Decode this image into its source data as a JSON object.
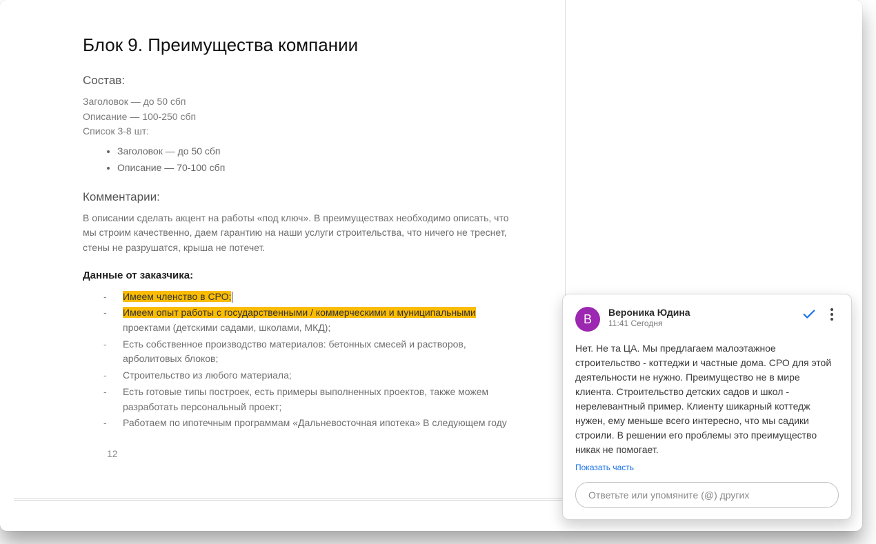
{
  "doc": {
    "title": "Блок 9. Преимущества компании",
    "sostav_heading": "Состав:",
    "sostav_lines": {
      "l1": "Заголовок — до 50 сбп",
      "l2": "Описание — 100-250 сбп",
      "l3": "Список 3-8 шт:"
    },
    "sostav_bullets": {
      "b1": "Заголовок — до 50 сбп",
      "b2": "Описание  — 70-100 сбп"
    },
    "comments_heading": "Комментарии:",
    "comments_para": "В описании сделать акцент на работы «под ключ».  В преимуществах необходимо описать, что мы строим качественно, даем гарантию на наши услуги строительства, что ничего не треснет, стены не разрушатся, крыша не потечет.",
    "client_data_heading": "Данные от заказчика:",
    "client_items": {
      "i1_hl": "Имеем членство в СРО;",
      "i2_hl": "Имеем опыт работы с государственными / коммерческими и муниципальными",
      "i2_rest": " проектами (детскими садами, школами, МКД);",
      "i3": "Есть собственное производство материалов: бетонных смесей и растворов, арболитовых блоков;",
      "i4": "Строительство из любого материала;",
      "i5": "Есть готовые типы построек, есть примеры выполненных проектов, также можем разработать персональный проект;",
      "i6": "Работаем по ипотечным программам «Дальневосточная ипотека» В следующем году"
    },
    "page_number": "12"
  },
  "comment": {
    "avatar_initial": "В",
    "author": "Вероника Юдина",
    "time": "11:41 Сегодня",
    "body": "Нет. Не та ЦА. Мы предлагаем малоэтажное строительство - коттеджи и частные дома. СРО для этой деятельности не нужно. Преимущество не в мире клиента. Строительство детских садов и школ - нерелевантный пример. Клиенту шикарный коттедж нужен, ему меньше всего интересно, что мы садики строили. В решении его проблемы это преимущество никак не помогает.",
    "show_part": "Показать часть",
    "reply_placeholder": "Ответьте или упомяните (@) других"
  }
}
